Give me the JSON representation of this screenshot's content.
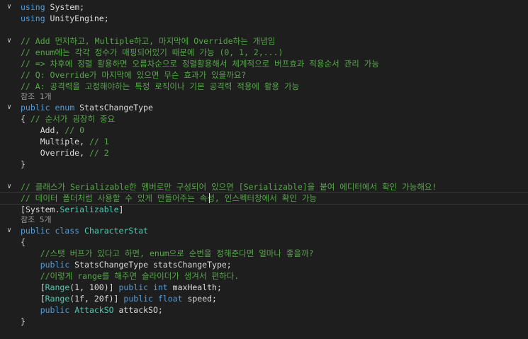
{
  "editor": {
    "lines": [
      {
        "fold": "v",
        "tokens": [
          {
            "t": "kw",
            "v": "using"
          },
          {
            "t": "pl",
            "v": " System;"
          }
        ]
      },
      {
        "fold": "",
        "tokens": [
          {
            "t": "kw",
            "v": "using"
          },
          {
            "t": "pl",
            "v": " UnityEngine;"
          }
        ]
      },
      {
        "fold": "",
        "tokens": []
      },
      {
        "fold": "v",
        "tokens": [
          {
            "t": "cm",
            "v": "// Add 먼저하고, Multiple하고, 마지막에 Override하는 개념임"
          }
        ]
      },
      {
        "fold": "",
        "tokens": [
          {
            "t": "cm",
            "v": "// enum에는 각각 정수가 매핑되어있기 때문에 가능 (0, 1, 2,...)"
          }
        ]
      },
      {
        "fold": "",
        "tokens": [
          {
            "t": "cm",
            "v": "// => 차후에 정렬 활용하면 오름차순으로 정렬활용해서 체계적으로 버프효과 적용순서 관리 가능"
          }
        ]
      },
      {
        "fold": "",
        "tokens": [
          {
            "t": "cm",
            "v": "// Q: Override가 마지막에 있으면 무슨 효과가 있을까요?"
          }
        ]
      },
      {
        "fold": "",
        "tokens": [
          {
            "t": "cm",
            "v": "// A: 공격력을 고정해야하는 특정 로직이나 기본 공격력 적용에 활용 가능"
          }
        ]
      },
      {
        "fold": "",
        "lens": true,
        "tokens": [
          {
            "t": "lens",
            "v": "참조 1개"
          }
        ]
      },
      {
        "fold": "v",
        "tokens": [
          {
            "t": "kw",
            "v": "public enum"
          },
          {
            "t": "pl",
            "v": " StatsChangeType"
          }
        ]
      },
      {
        "fold": "",
        "tokens": [
          {
            "t": "pl",
            "v": "{ "
          },
          {
            "t": "cm",
            "v": "// 순서가 굉장히 중요"
          }
        ]
      },
      {
        "fold": "",
        "tokens": [
          {
            "t": "pl",
            "v": "    Add, "
          },
          {
            "t": "cm",
            "v": "// 0"
          }
        ]
      },
      {
        "fold": "",
        "tokens": [
          {
            "t": "pl",
            "v": "    Multiple, "
          },
          {
            "t": "cm",
            "v": "// 1"
          }
        ]
      },
      {
        "fold": "",
        "tokens": [
          {
            "t": "pl",
            "v": "    Override, "
          },
          {
            "t": "cm",
            "v": "// 2"
          }
        ]
      },
      {
        "fold": "",
        "tokens": [
          {
            "t": "pl",
            "v": "}"
          }
        ]
      },
      {
        "fold": "",
        "tokens": []
      },
      {
        "fold": "v",
        "tokens": [
          {
            "t": "cm",
            "v": "// 클래스가 Serializable한 멤버로만 구성되어 있으면 [Serializable]을 붙여 에디터에서 확인 가능해요!"
          }
        ]
      },
      {
        "fold": "",
        "cursor": true,
        "tokens": [
          {
            "t": "cm",
            "v": "// 데이터 폴더처럼 사용할 수 있게 만들어주는 속성, 인스펙터창에서 확인 가능"
          }
        ]
      },
      {
        "fold": "",
        "tokens": [
          {
            "t": "pl",
            "v": "["
          },
          {
            "t": "pl",
            "v": "System."
          },
          {
            "t": "at",
            "v": "Serializable"
          },
          {
            "t": "pl",
            "v": "]"
          }
        ]
      },
      {
        "fold": "",
        "lens": true,
        "tokens": [
          {
            "t": "lens",
            "v": "참조 5개"
          }
        ]
      },
      {
        "fold": "v",
        "tokens": [
          {
            "t": "kw",
            "v": "public class"
          },
          {
            "t": "pl",
            "v": " "
          },
          {
            "t": "ty",
            "v": "CharacterStat"
          }
        ]
      },
      {
        "fold": "",
        "tokens": [
          {
            "t": "pl",
            "v": "{"
          }
        ]
      },
      {
        "fold": "",
        "tokens": [
          {
            "t": "pl",
            "v": "    "
          },
          {
            "t": "cm",
            "v": "//스탯 버프가 있다고 하면, enum으로 순번을 정해준다면 얼마나 좋을까?"
          }
        ]
      },
      {
        "fold": "",
        "tokens": [
          {
            "t": "pl",
            "v": "    "
          },
          {
            "t": "kw",
            "v": "public"
          },
          {
            "t": "pl",
            "v": " StatsChangeType statsChangeType;"
          }
        ]
      },
      {
        "fold": "",
        "tokens": [
          {
            "t": "pl",
            "v": "    "
          },
          {
            "t": "cm",
            "v": "//이렇게 range를 해주면 슬라이더가 생겨서 편하다."
          }
        ]
      },
      {
        "fold": "",
        "tokens": [
          {
            "t": "pl",
            "v": "    ["
          },
          {
            "t": "at",
            "v": "Range"
          },
          {
            "t": "pl",
            "v": "(1, 100)] "
          },
          {
            "t": "kw",
            "v": "public int"
          },
          {
            "t": "pl",
            "v": " maxHealth;"
          }
        ]
      },
      {
        "fold": "",
        "tokens": [
          {
            "t": "pl",
            "v": "    ["
          },
          {
            "t": "at",
            "v": "Range"
          },
          {
            "t": "pl",
            "v": "(1f, 20f)] "
          },
          {
            "t": "kw",
            "v": "public float"
          },
          {
            "t": "pl",
            "v": " speed;"
          }
        ]
      },
      {
        "fold": "",
        "tokens": [
          {
            "t": "pl",
            "v": "    "
          },
          {
            "t": "kw",
            "v": "public"
          },
          {
            "t": "pl",
            "v": " "
          },
          {
            "t": "ty",
            "v": "AttackSO"
          },
          {
            "t": "pl",
            "v": " attackSO;"
          }
        ]
      },
      {
        "fold": "",
        "tokens": [
          {
            "t": "pl",
            "v": "}"
          }
        ]
      }
    ]
  }
}
